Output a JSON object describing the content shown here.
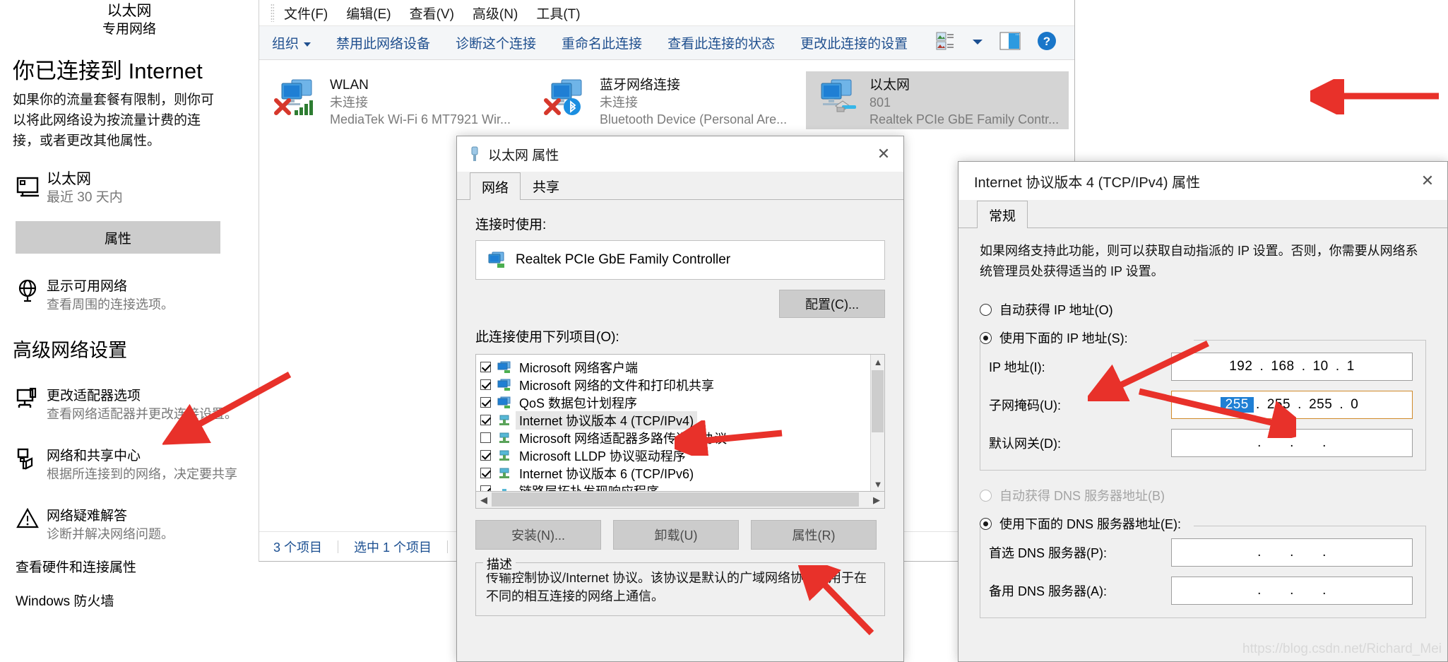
{
  "settings": {
    "network_header": {
      "name": "以太网",
      "type": "专用网络"
    },
    "title": "你已连接到 Internet",
    "description": "如果你的流量套餐有限制，则你可以将此网络设为按流量计费的连接，或者更改其他属性。",
    "connection": {
      "name": "以太网",
      "sub": "最近 30 天内",
      "icon": "monitor-icon"
    },
    "properties_button": "属性",
    "options": [
      {
        "icon": "globe-icon",
        "title": "显示可用网络",
        "sub": "查看周围的连接选项。"
      }
    ],
    "advanced_heading": "高级网络设置",
    "advanced_options": [
      {
        "icon": "adapter-monitor-icon",
        "title": "更改适配器选项",
        "sub": "查看网络适配器并更改连接设置。"
      },
      {
        "icon": "sharing-icon",
        "title": "网络和共享中心",
        "sub": "根据所连接到的网络，决定要共享"
      },
      {
        "icon": "warning-triangle-icon",
        "title": "网络疑难解答",
        "sub": "诊断并解决网络问题。"
      }
    ],
    "links": [
      "查看硬件和连接属性",
      "Windows 防火墙"
    ]
  },
  "netconn": {
    "menu": [
      "文件(F)",
      "编辑(E)",
      "查看(V)",
      "高级(N)",
      "工具(T)"
    ],
    "toolbar": {
      "organize": "组织",
      "items": [
        "禁用此网络设备",
        "诊断这个连接",
        "重命名此连接",
        "查看此连接的状态",
        "更改此连接的设置"
      ],
      "right_icons": [
        "view-mode-icon",
        "chevron-down-icon",
        "preview-pane-icon",
        "help-icon"
      ]
    },
    "adapters": [
      {
        "name": "WLAN",
        "status": "未连接",
        "device": "MediaTek Wi-Fi 6 MT7921 Wir...",
        "selected": false,
        "badge": "wifi-signal-icon",
        "disabled": true
      },
      {
        "name": "蓝牙网络连接",
        "status": "未连接",
        "device": "Bluetooth Device (Personal Are...",
        "selected": false,
        "badge": "bluetooth-icon",
        "disabled": true
      },
      {
        "name": "以太网",
        "status": "801",
        "device": "Realtek PCIe GbE Family Contr...",
        "selected": true,
        "badge": "ethernet-plug-icon",
        "disabled": false
      }
    ],
    "status_bar": {
      "count": "3 个项目",
      "selected": "选中 1 个项目"
    }
  },
  "eth_dialog": {
    "title": "以太网 属性",
    "close_icon": "close-icon",
    "tabs": [
      {
        "label": "网络",
        "active": true
      },
      {
        "label": "共享",
        "active": false
      }
    ],
    "connect_using_label": "连接时使用:",
    "adapter_name": "Realtek PCIe GbE Family Controller",
    "configure_button": "配置(C)...",
    "items_label": "此连接使用下列项目(O):",
    "items": [
      {
        "label": "Microsoft 网络客户端",
        "checked": true,
        "selected": false,
        "icon": "client-icon"
      },
      {
        "label": "Microsoft 网络的文件和打印机共享",
        "checked": true,
        "selected": false,
        "icon": "client-icon"
      },
      {
        "label": "QoS 数据包计划程序",
        "checked": true,
        "selected": false,
        "icon": "client-icon"
      },
      {
        "label": "Internet 协议版本 4 (TCP/IPv4)",
        "checked": true,
        "selected": true,
        "icon": "protocol-icon"
      },
      {
        "label": "Microsoft 网络适配器多路传送器协议",
        "checked": false,
        "selected": false,
        "icon": "protocol-icon"
      },
      {
        "label": "Microsoft LLDP 协议驱动程序",
        "checked": true,
        "selected": false,
        "icon": "protocol-icon"
      },
      {
        "label": "Internet 协议版本 6 (TCP/IPv6)",
        "checked": true,
        "selected": false,
        "icon": "protocol-icon"
      },
      {
        "label": "链路层拓扑发现响应程序",
        "checked": true,
        "selected": false,
        "icon": "protocol-icon"
      }
    ],
    "buttons": {
      "install": "安装(N)...",
      "uninstall": "卸载(U)",
      "properties": "属性(R)"
    },
    "description_legend": "描述",
    "description_text": "传输控制协议/Internet 协议。该协议是默认的广域网络协议，用于在不同的相互连接的网络上通信。"
  },
  "ip_dialog": {
    "title": "Internet 协议版本 4 (TCP/IPv4) 属性",
    "close_icon": "close-icon",
    "tabs": [
      {
        "label": "常规",
        "active": true
      }
    ],
    "description": "如果网络支持此功能，则可以获取自动指派的 IP 设置。否则，你需要从网络系统管理员处获得适当的 IP 设置。",
    "ip_auto_label": "自动获得 IP 地址(O)",
    "ip_manual_label": "使用下面的 IP 地址(S):",
    "ip_mode": "manual",
    "fields": [
      {
        "label": "IP 地址(I):",
        "octets": [
          "192",
          "168",
          "10",
          "1"
        ],
        "focused": false,
        "selected_octet": -1
      },
      {
        "label": "子网掩码(U):",
        "octets": [
          "255",
          "255",
          "255",
          "0"
        ],
        "focused": true,
        "selected_octet": 0
      },
      {
        "label": "默认网关(D):",
        "octets": [
          "",
          "",
          "",
          ""
        ],
        "focused": false,
        "selected_octet": -1
      }
    ],
    "dns_auto_label": "自动获得 DNS 服务器地址(B)",
    "dns_manual_label": "使用下面的 DNS 服务器地址(E):",
    "dns_mode": "manual",
    "dns_fields": [
      {
        "label": "首选 DNS 服务器(P):",
        "octets": [
          "",
          "",
          "",
          ""
        ]
      },
      {
        "label": "备用 DNS 服务器(A):",
        "octets": [
          "",
          "",
          "",
          ""
        ]
      }
    ]
  },
  "watermark": "https://blog.csdn.net/Richard_Mei",
  "colors": {
    "accent": "#0078d4",
    "arrow": "#e8312a",
    "selection": "#1f7fd4",
    "link": "#20508f"
  }
}
